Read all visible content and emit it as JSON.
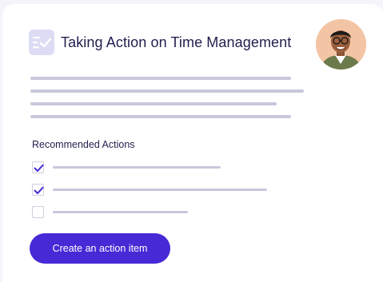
{
  "header": {
    "title": "Taking Action on Time Management",
    "title_icon": "checklist-icon",
    "avatar": "user-avatar-photo"
  },
  "recommended_actions": {
    "heading": "Recommended Actions",
    "items": [
      {
        "checked": true
      },
      {
        "checked": true
      },
      {
        "checked": false
      }
    ]
  },
  "cta": {
    "label": "Create an action item"
  },
  "colors": {
    "accent": "#4928d6",
    "title_text": "#1f1f4d",
    "placeholder_line": "#c8c8db",
    "icon_bg": "#dcdcf5",
    "page_bg": "#f4f4fa"
  }
}
